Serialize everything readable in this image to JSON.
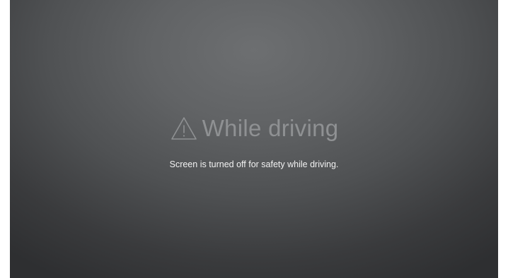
{
  "screen": {
    "title": "While driving",
    "message": "Screen is turned off for safety while driving.",
    "icon": "warning-icon"
  },
  "colors": {
    "background_center": "#6d6f71",
    "background_edge": "#2e2f31",
    "title_text": "#8f9193",
    "message_text": "#f2f2f2"
  }
}
